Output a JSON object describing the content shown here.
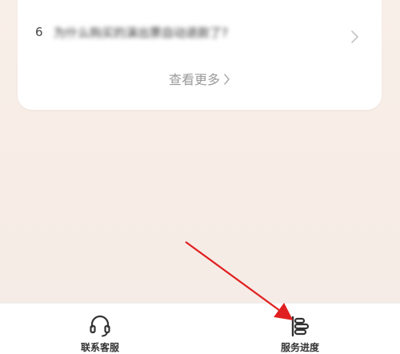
{
  "faq": {
    "items": [
      {
        "index": "6",
        "text": "为什么购买的演出票自动退款了?"
      }
    ],
    "more_label": "查看更多"
  },
  "bottom_nav": {
    "items": [
      {
        "label": "联系客服",
        "icon": "headset-icon"
      },
      {
        "label": "服务进度",
        "icon": "service-progress-icon"
      }
    ]
  },
  "annotation": {
    "color": "#e02020"
  }
}
